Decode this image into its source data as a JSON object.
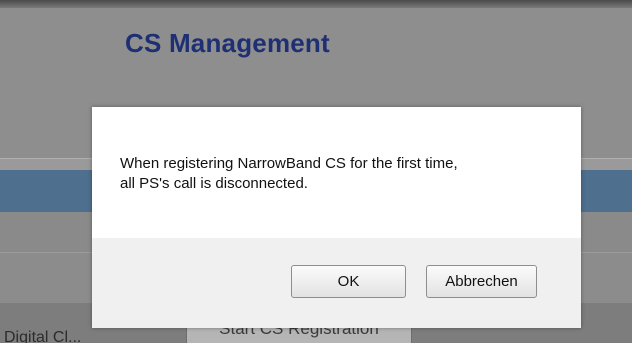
{
  "header": {
    "title": "CS Management"
  },
  "background": {
    "button_label": "Start CS Registration",
    "left_label": "Digital Cl..."
  },
  "dialog": {
    "message_line1": "When registering NarrowBand CS for the first time,",
    "message_line2": "all PS's call is disconnected.",
    "ok_label": "OK",
    "cancel_label": "Abbrechen"
  },
  "colors": {
    "title": "#1e2f73",
    "header_bar": "#4e6f8e",
    "overlay_gray": "#8e8e8e",
    "dialog_bg": "#ffffff",
    "dialog_footer_bg": "#f0f0f0"
  }
}
